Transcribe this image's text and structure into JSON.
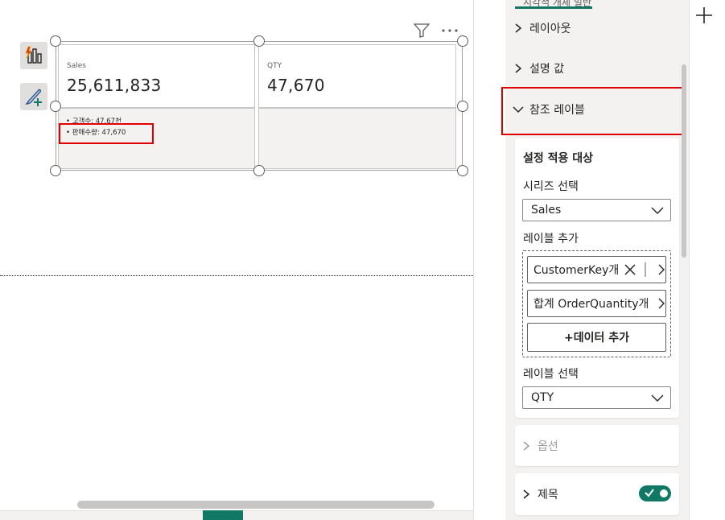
{
  "visual": {
    "cards": [
      {
        "label": "Sales",
        "value": "25,611,833"
      },
      {
        "label": "QTY",
        "value": "47,670"
      }
    ],
    "reference_labels": [
      "• 고객수: 47.67천",
      "• 판매수량: 47,670"
    ]
  },
  "toolbar_icons": [
    "filter-icon",
    "more-options-icon"
  ],
  "left_tools": [
    "build-visual-icon",
    "format-visual-icon"
  ],
  "panel": {
    "tabs_peek": "시각적 개체  일반",
    "sections": {
      "layout": "레이아웃",
      "callout": "설명 값",
      "reference_labels": "참조 레이블",
      "options": "옵션",
      "title": "제목"
    },
    "apply_settings_to": "설정 적용 대상",
    "series_select_label": "시리즈 선택",
    "series_select_value": "Sales",
    "add_label_label": "레이블 추가",
    "chips": [
      "CustomerKey개",
      "합계 OrderQuantity개"
    ],
    "add_data_button": "+데이터 추가",
    "label_select_label": "레이블 선택",
    "label_select_value": "QTY",
    "title_toggle": true
  },
  "colors": {
    "accent": "#117865",
    "highlight": "#e00000"
  }
}
